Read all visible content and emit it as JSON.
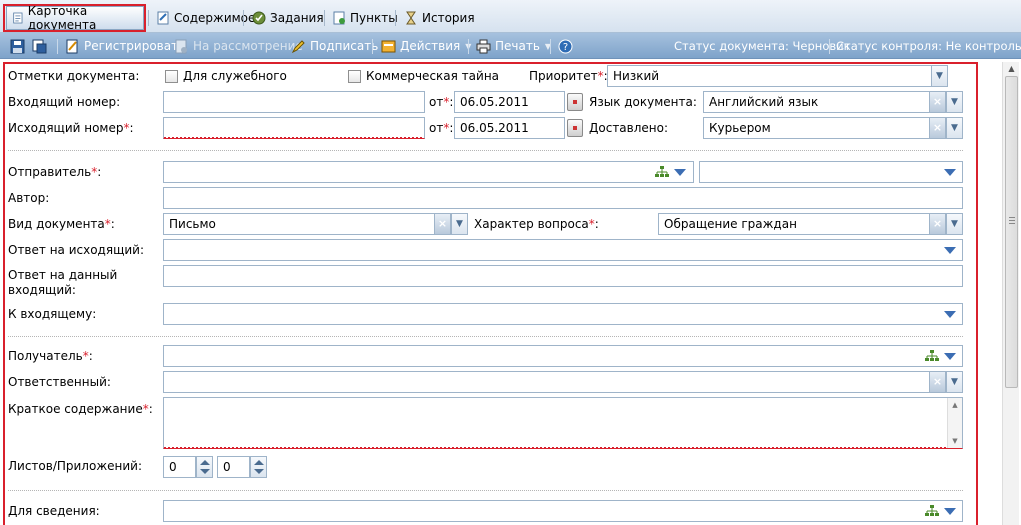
{
  "tabs": [
    {
      "label": "Карточка документа",
      "icon": "document-card-icon"
    },
    {
      "label": "Содержимое",
      "icon": "content-icon"
    },
    {
      "label": "Задания",
      "icon": "tasks-icon"
    },
    {
      "label": "Пункты",
      "icon": "items-icon"
    },
    {
      "label": "История",
      "icon": "hourglass-icon"
    }
  ],
  "toolbar": {
    "register": "Регистрировать",
    "review": "На рассмотрение",
    "sign": "Подписать",
    "actions": "Действия",
    "print": "Печать",
    "doc_status": "Статус документа: Черновик",
    "control_status": "Статус контроля: Не контрольный"
  },
  "form": {
    "marks_label": "Отметки документа:",
    "for_official": "Для служебного",
    "commercial_secret": "Коммерческая тайна",
    "priority_label": "Приоритет",
    "priority_value": "Низкий",
    "incoming_number_label": "Входящий номер:",
    "outgoing_number_label": "Исходящий номер",
    "from_label": "от",
    "incoming_date": "06.05.2011",
    "outgoing_date": "06.05.2011",
    "language_label": "Язык документа:",
    "language_value": "Английский язык",
    "delivered_label": "Доставлено:",
    "delivered_value": "Курьером",
    "sender_label": "Отправитель",
    "author_label": "Автор:",
    "doc_type_label": "Вид документа",
    "doc_type_value": "Письмо",
    "question_type_label": "Характер вопроса",
    "question_type_value": "Обращение граждан",
    "reply_outgoing_label": "Ответ на исходящий:",
    "reply_incoming_label_1": "Ответ на данный",
    "reply_incoming_label_2": "входящий:",
    "to_incoming_label": "К входящему:",
    "recipient_label": "Получатель",
    "responsible_label": "Ответственный:",
    "summary_label": "Краткое содержание",
    "sheets_label": "Листов/Приложений:",
    "sheets_value": "0",
    "attachments_value": "0",
    "for_info_label": "Для сведения:",
    "required_mark": "*",
    "colon": ":"
  },
  "colors": {
    "accent_red": "#d9202c",
    "toolbar_blue": "#7ea3ca",
    "link_blue": "#3b6db3"
  }
}
